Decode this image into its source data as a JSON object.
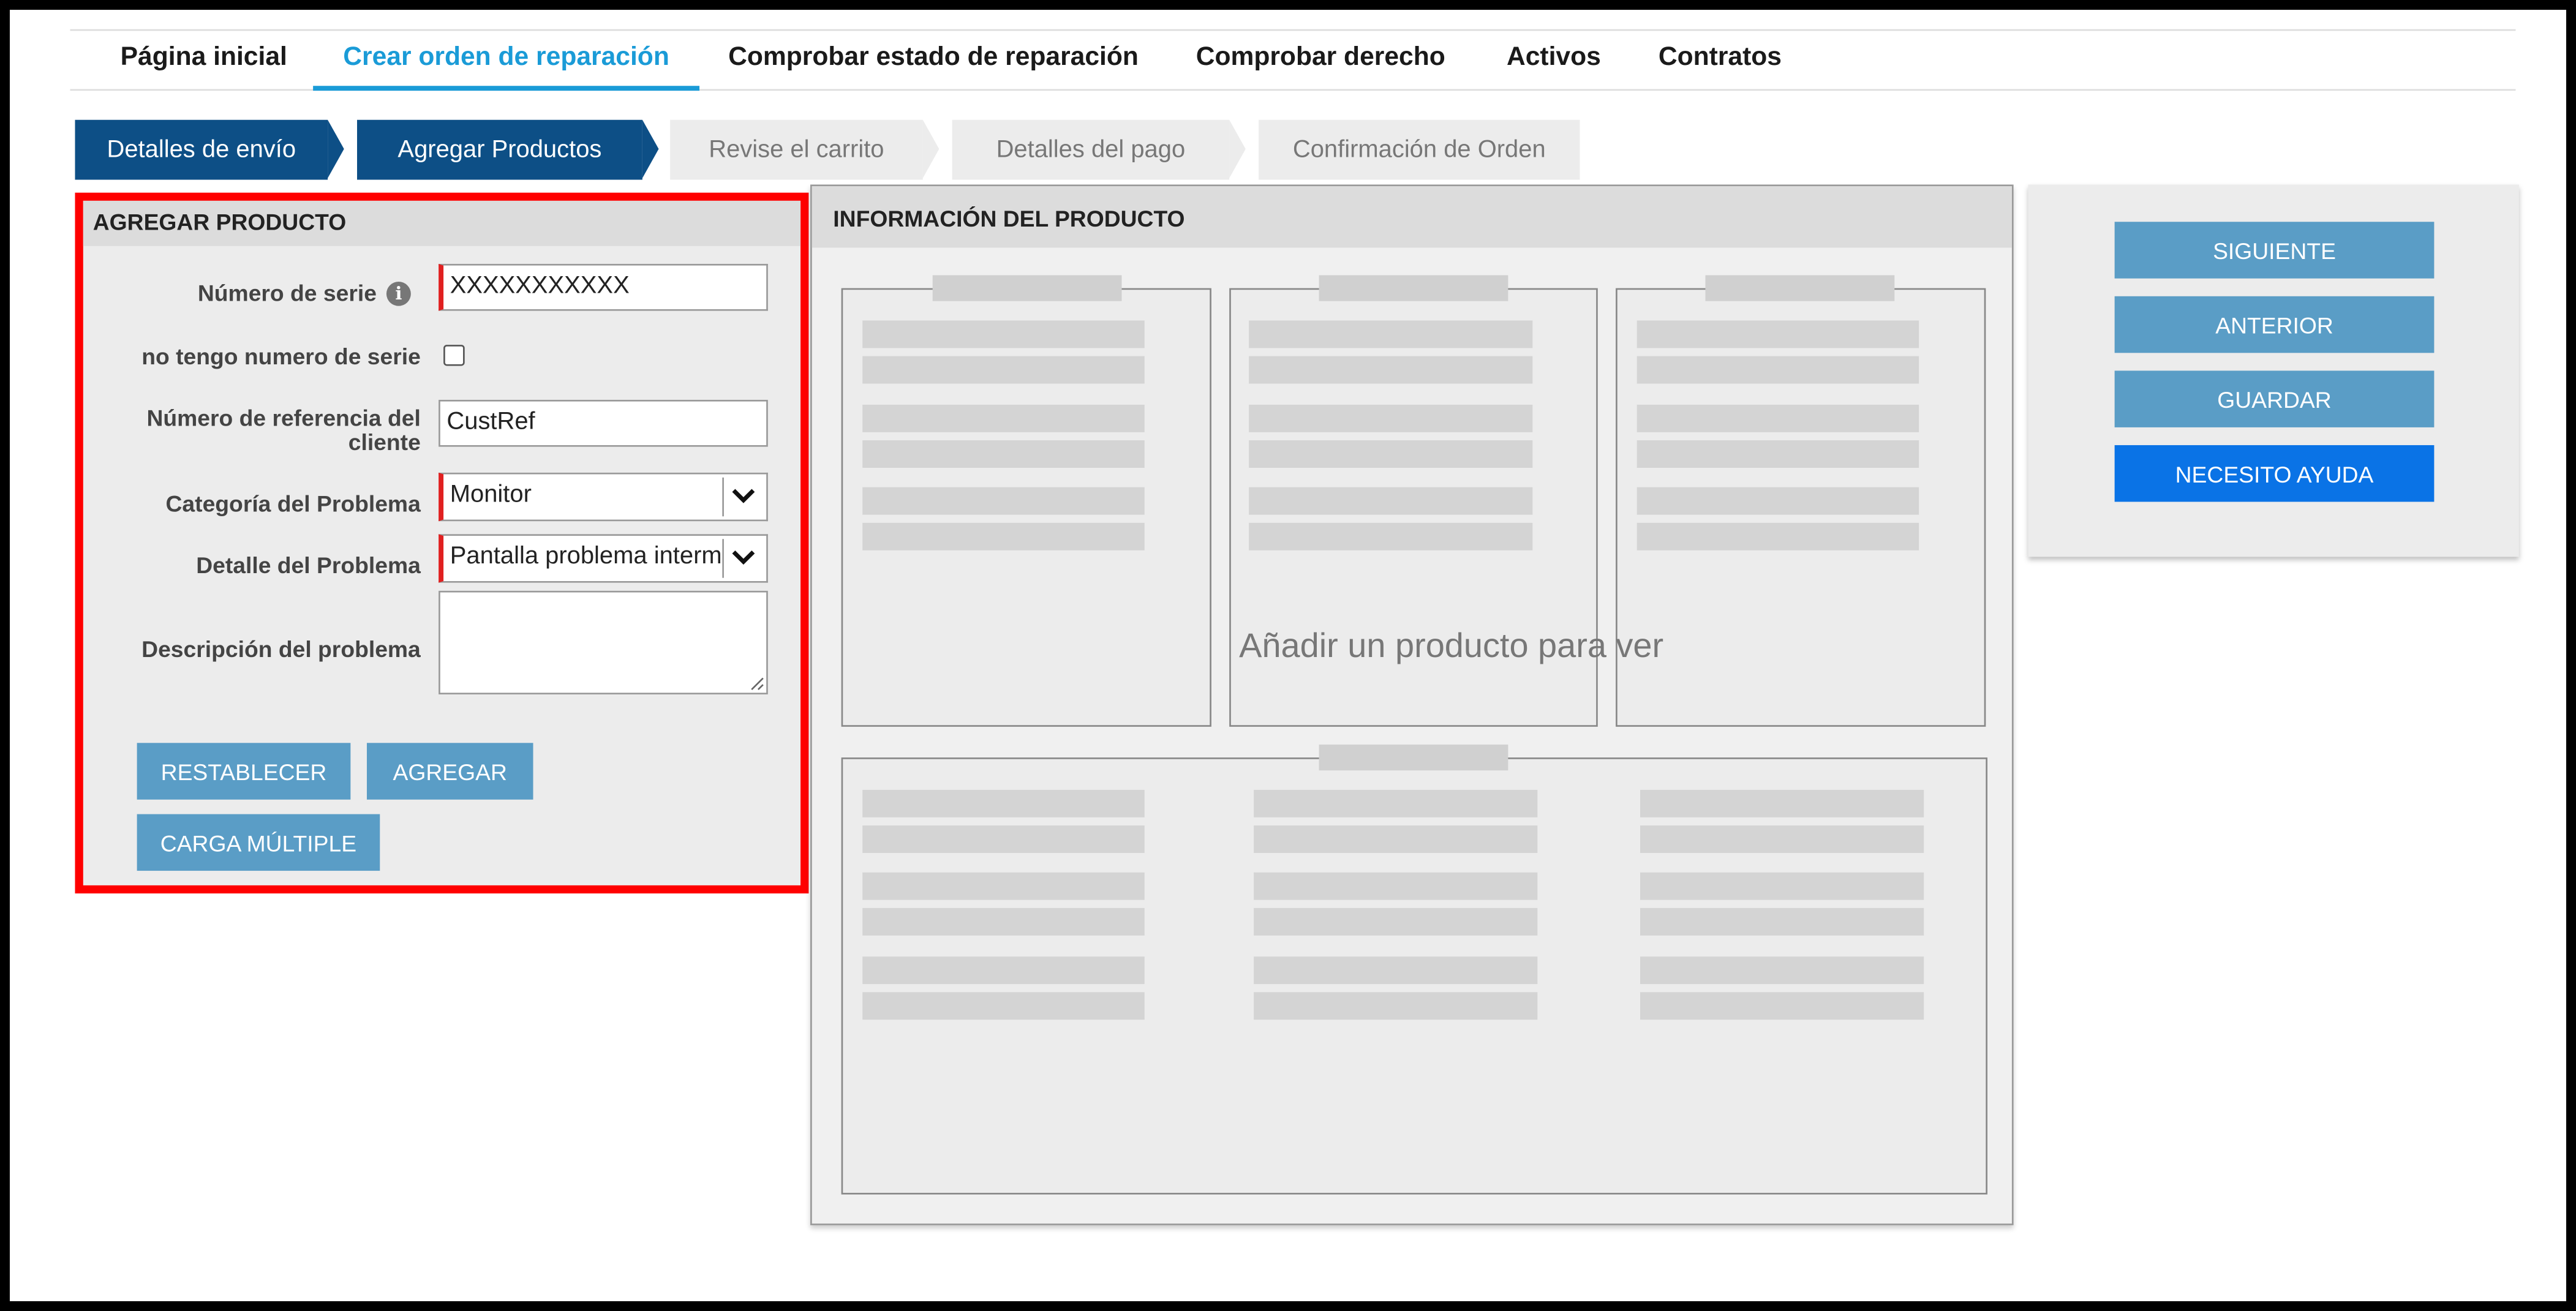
{
  "nav": {
    "items": [
      "Página inicial",
      "Crear orden de reparación",
      "Comprobar estado de reparación",
      "Comprobar derecho",
      "Activos",
      "Contratos"
    ],
    "active": "Crear orden de reparación"
  },
  "steps": {
    "items": [
      "Detalles de envío",
      "Agregar Productos",
      "Revise el carrito",
      "Detalles del pago",
      "Confirmación de Orden"
    ],
    "completed_count": 2
  },
  "add_product": {
    "title": "AGREGAR PRODUCTO",
    "serial_label": "Número de serie",
    "serial_value": "XXXXXXXXXXX",
    "no_serial_label": "no tengo numero de serie",
    "no_serial_checked": false,
    "customer_ref_label_line1": "Número de referencia del",
    "customer_ref_label_line2": "cliente",
    "customer_ref_value": "CustRef",
    "category_label": "Categoría del Problema",
    "category_value": "Monitor",
    "detail_label": "Detalle del Problema",
    "detail_value": "Pantalla problema interm",
    "description_label": "Descripción del problema",
    "description_value": "",
    "buttons": {
      "reset": "RESTABLECER",
      "add": "AGREGAR",
      "bulk_upload": "CARGA MÚLTIPLE"
    }
  },
  "product_info": {
    "title": "INFORMACIÓN DEL PRODUCTO",
    "placeholder": "Añadir un producto para ver"
  },
  "actions": {
    "next": "SIGUIENTE",
    "previous": "ANTERIOR",
    "save": "GUARDAR",
    "help": "NECESITO AYUDA"
  },
  "colors": {
    "accent": "#1a9bd7",
    "step_done": "#0d4f86",
    "button": "#5a9dc6",
    "help_button": "#0a73e6",
    "highlight": "#ff0000"
  }
}
